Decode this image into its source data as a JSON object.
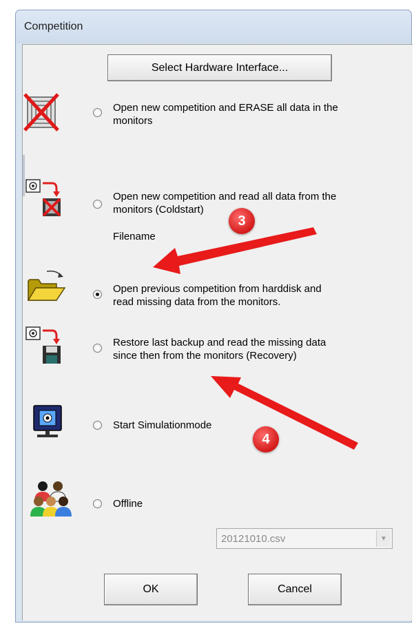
{
  "window": {
    "title": "Competition"
  },
  "buttons": {
    "select_hardware": "Select Hardware Interface...",
    "ok": "OK",
    "cancel": "Cancel"
  },
  "options": [
    {
      "label_line1": "Open new competition and ERASE all data in the",
      "label_line2": "monitors",
      "checked": false,
      "icon": "erase-monitors-icon"
    },
    {
      "label_line1": "Open new competition and read all data from the",
      "label_line2": "monitors (Coldstart)",
      "checked": false,
      "icon": "coldstart-icon"
    },
    {
      "label_line1": "Open previous competition from harddisk and",
      "label_line2": "read missing data from the monitors.",
      "checked": true,
      "icon": "open-folder-icon"
    },
    {
      "label_line1": "Restore last backup and read the missing data",
      "label_line2": "since then from the monitors (Recovery)",
      "checked": false,
      "icon": "recovery-disk-icon"
    },
    {
      "label_line1": "Start Simulationmode",
      "checked": false,
      "icon": "monitor-icon"
    },
    {
      "label_line1": "Offline",
      "checked": false,
      "icon": "people-group-icon"
    }
  ],
  "filename_label": "Filename",
  "file_select": {
    "value": "20121010.csv"
  },
  "annotations": [
    {
      "number": "3",
      "color": "#e02020"
    },
    {
      "number": "4",
      "color": "#e02020"
    }
  ]
}
